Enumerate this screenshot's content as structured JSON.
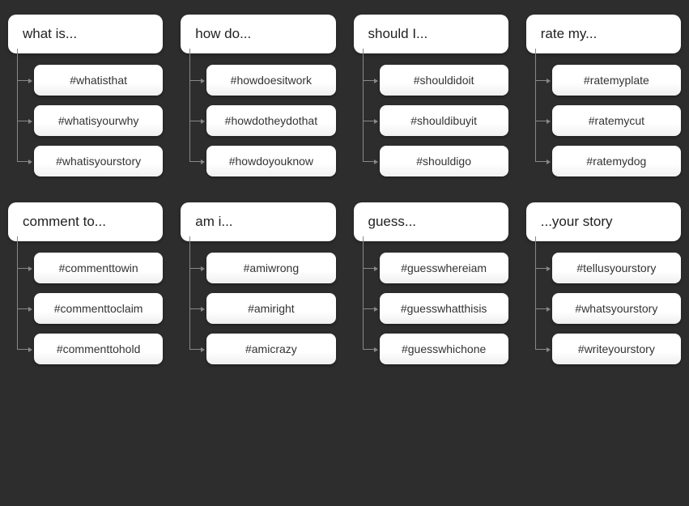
{
  "groups": [
    {
      "header": "what is...",
      "children": [
        "#whatisthat",
        "#whatisyourwhy",
        "#whatisyourstory"
      ]
    },
    {
      "header": "how do...",
      "children": [
        "#howdoesitwork",
        "#howdotheydothat",
        "#howdoyouknow"
      ]
    },
    {
      "header": "should I...",
      "children": [
        "#shouldidoit",
        "#shouldibuyit",
        "#shouldigo"
      ]
    },
    {
      "header": "rate my...",
      "children": [
        "#ratemyplate",
        "#ratemycut",
        "#ratemydog"
      ]
    },
    {
      "header": "comment to...",
      "children": [
        "#commenttowin",
        "#commenttoclaim",
        "#commenttohold"
      ]
    },
    {
      "header": "am i...",
      "children": [
        "#amiwrong",
        "#amiright",
        "#amicrazy"
      ]
    },
    {
      "header": "guess...",
      "children": [
        "#guesswhereiam",
        "#guesswhatthisis",
        "#guesswhichone"
      ]
    },
    {
      "header": "...your story",
      "children": [
        "#tellusyourstory",
        "#whatsyourstory",
        "#writeyourstory"
      ]
    }
  ]
}
